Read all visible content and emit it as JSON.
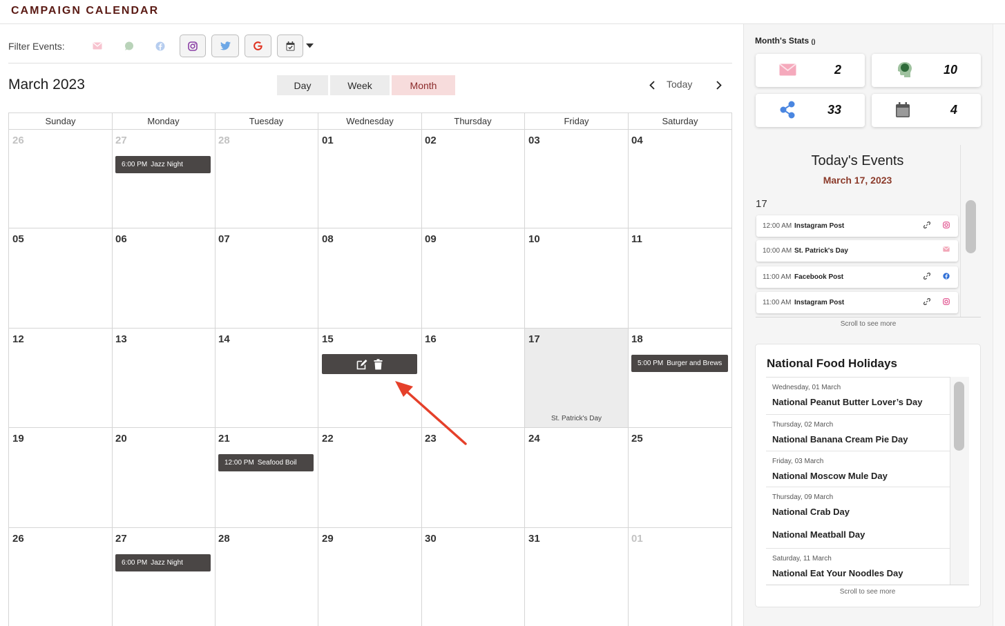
{
  "app": {
    "title": "CAMPAIGN CALENDAR"
  },
  "filters": {
    "label": "Filter Events:",
    "buttons": [
      {
        "name": "email",
        "icon": "envelope-icon",
        "color": "#f2a7b8"
      },
      {
        "name": "sms",
        "icon": "chat-bubble-icon",
        "color": "#9fbf9f"
      },
      {
        "name": "facebook",
        "icon": "facebook-icon",
        "color": "#a9c4ec"
      },
      {
        "name": "instagram",
        "icon": "instagram-icon",
        "color": "#8a3ea5"
      },
      {
        "name": "twitter",
        "icon": "twitter-icon",
        "color": "#6ea8e6"
      },
      {
        "name": "google",
        "icon": "google-icon",
        "color": "#e0301e"
      },
      {
        "name": "calendar",
        "icon": "calendar-check-icon",
        "color": "#444444"
      }
    ]
  },
  "header": {
    "month_title": "March 2023",
    "views": [
      "Day",
      "Week",
      "Month"
    ],
    "active_view": "Month",
    "today_label": "Today"
  },
  "calendar": {
    "weekdays": [
      "Sunday",
      "Monday",
      "Tuesday",
      "Wednesday",
      "Thursday",
      "Friday",
      "Saturday"
    ],
    "weeks": [
      [
        {
          "day": "26",
          "muted": true
        },
        {
          "day": "27",
          "muted": true,
          "events": [
            {
              "time": "6:00 PM",
              "name": "Jazz Night"
            }
          ]
        },
        {
          "day": "28",
          "muted": true
        },
        {
          "day": "01"
        },
        {
          "day": "02"
        },
        {
          "day": "03"
        },
        {
          "day": "04"
        }
      ],
      [
        {
          "day": "05"
        },
        {
          "day": "06"
        },
        {
          "day": "07"
        },
        {
          "day": "08"
        },
        {
          "day": "09"
        },
        {
          "day": "10"
        },
        {
          "day": "11"
        }
      ],
      [
        {
          "day": "12"
        },
        {
          "day": "13"
        },
        {
          "day": "14"
        },
        {
          "day": "15",
          "actions": true
        },
        {
          "day": "16"
        },
        {
          "day": "17",
          "today": true,
          "holiday": "St. Patrick's Day"
        },
        {
          "day": "18",
          "events": [
            {
              "time": "5:00 PM",
              "name": "Burger and Brews"
            }
          ]
        }
      ],
      [
        {
          "day": "19"
        },
        {
          "day": "20"
        },
        {
          "day": "21",
          "events": [
            {
              "time": "12:00 PM",
              "name": "Seafood Boil"
            }
          ]
        },
        {
          "day": "22"
        },
        {
          "day": "23"
        },
        {
          "day": "24"
        },
        {
          "day": "25"
        }
      ],
      [
        {
          "day": "26"
        },
        {
          "day": "27",
          "events": [
            {
              "time": "6:00 PM",
              "name": "Jazz Night"
            }
          ]
        },
        {
          "day": "28"
        },
        {
          "day": "29"
        },
        {
          "day": "30"
        },
        {
          "day": "31"
        },
        {
          "day": "01",
          "muted": true
        }
      ]
    ]
  },
  "stats": {
    "title": "Month's Stats",
    "info_glyph": "()",
    "cards": [
      {
        "icon": "envelope-icon",
        "value": "2"
      },
      {
        "icon": "head-bubble-icon",
        "value": "10"
      },
      {
        "icon": "share-nodes-icon",
        "value": "33"
      },
      {
        "icon": "calendar-icon",
        "value": "4"
      }
    ]
  },
  "todays_events": {
    "title": "Today's Events",
    "date": "March 17, 2023",
    "day": "17",
    "items": [
      {
        "time": "12:00 AM",
        "name": "Instagram Post",
        "source": "instagram-icon",
        "link": true
      },
      {
        "time": "10:00 AM",
        "name": "St. Patrick's Day",
        "source": "envelope-icon",
        "link": false
      },
      {
        "time": "11:00 AM",
        "name": "Facebook Post",
        "source": "facebook-icon",
        "link": true
      },
      {
        "time": "11:00 AM",
        "name": "Instagram Post",
        "source": "instagram-icon",
        "link": true
      }
    ],
    "scroll_hint": "Scroll to see more"
  },
  "food_holidays": {
    "title": "National Food Holidays",
    "items": [
      {
        "date": "Wednesday, 01 March",
        "name": "National Peanut Butter Lover’s Day"
      },
      {
        "date": "Thursday, 02 March",
        "name": "National Banana Cream Pie Day"
      },
      {
        "date": "Friday, 03 March",
        "name": "National Moscow Mule Day"
      },
      {
        "date": "Thursday, 09 March",
        "name": "National Crab Day"
      },
      {
        "date": "",
        "name": "National Meatball Day"
      },
      {
        "date": "Saturday, 11 March",
        "name": "National Eat Your Noodles Day"
      }
    ],
    "scroll_hint": "Scroll to see more"
  }
}
